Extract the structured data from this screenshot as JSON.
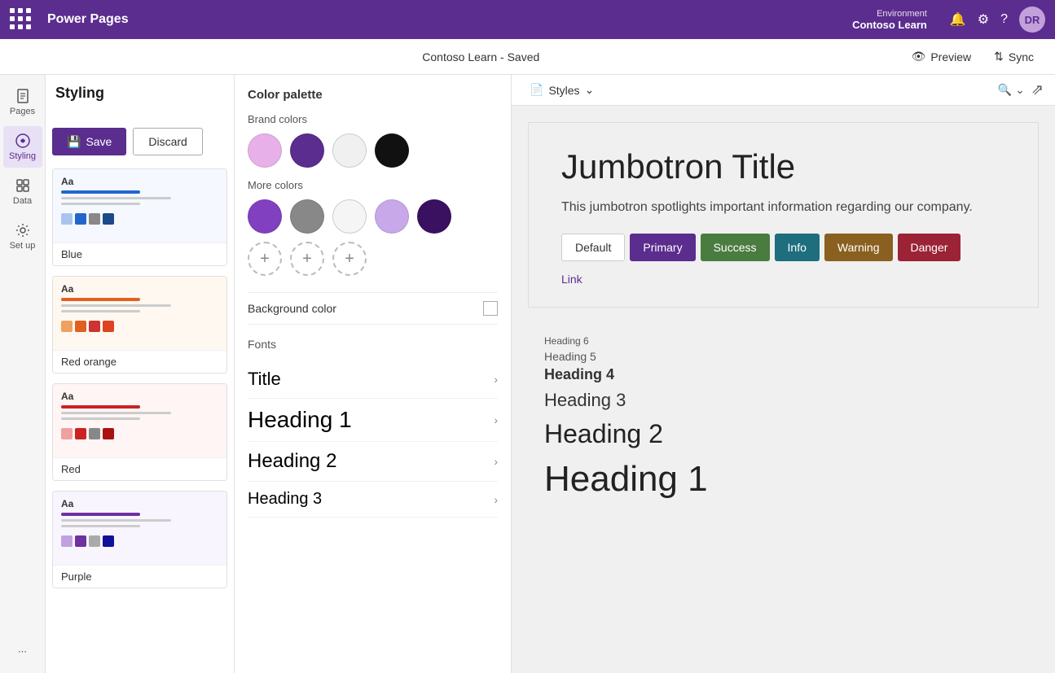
{
  "topnav": {
    "app_name": "Power Pages",
    "environment_label": "Environment",
    "environment_name": "Contoso Learn",
    "avatar_initials": "DR"
  },
  "secondarybar": {
    "title": "Contoso Learn - Saved",
    "preview_label": "Preview",
    "sync_label": "Sync"
  },
  "sidebar": {
    "items": [
      {
        "id": "pages",
        "label": "Pages"
      },
      {
        "id": "styling",
        "label": "Styling"
      },
      {
        "id": "data",
        "label": "Data"
      },
      {
        "id": "setup",
        "label": "Set up"
      }
    ]
  },
  "themes_panel": {
    "header": "Styling",
    "save_label": "Save",
    "discard_label": "Discard",
    "themes": [
      {
        "name": "Blue",
        "bar_color": "#2266cc",
        "swatches": [
          "#aac4f0",
          "#2266cc",
          "#888888",
          "#1a4a8a"
        ]
      },
      {
        "name": "Red orange",
        "bar_color": "#e06020",
        "swatches": [
          "#f0a060",
          "#e06020",
          "#cc3333",
          "#dd4422"
        ]
      },
      {
        "name": "Red",
        "bar_color": "#cc2222",
        "swatches": [
          "#f0a0a0",
          "#cc2222",
          "#888888",
          "#aa1111"
        ]
      },
      {
        "name": "Purple",
        "bar_color": "#7030a0",
        "swatches": [
          "#c0a0e0",
          "#7030a0",
          "#aaaaaa",
          "#111199"
        ]
      }
    ]
  },
  "color_palette": {
    "section_title": "Color palette",
    "brand_colors_label": "Brand colors",
    "brand_colors": [
      {
        "hex": "#e8b0e8",
        "name": "light purple"
      },
      {
        "hex": "#5b2d8e",
        "name": "purple"
      },
      {
        "hex": "#f0f0f0",
        "name": "light gray"
      },
      {
        "hex": "#111111",
        "name": "black"
      }
    ],
    "more_colors_label": "More colors",
    "more_colors": [
      {
        "hex": "#8040c0",
        "name": "medium purple"
      },
      {
        "hex": "#888888",
        "name": "gray"
      },
      {
        "hex": "#f5f5f5",
        "name": "near white"
      },
      {
        "hex": "#c8a8e8",
        "name": "lavender"
      },
      {
        "hex": "#3a1060",
        "name": "dark purple"
      }
    ]
  },
  "background_color": {
    "label": "Background color",
    "checked": false
  },
  "fonts": {
    "section_label": "Fonts",
    "items": [
      {
        "label": "Title",
        "size": "title"
      },
      {
        "label": "Heading 1",
        "size": "h1"
      },
      {
        "label": "Heading 2",
        "size": "h2"
      },
      {
        "label": "Heading 3",
        "size": "h3"
      }
    ]
  },
  "preview": {
    "styles_label": "Styles",
    "jumbotron": {
      "title": "Jumbotron Title",
      "text": "This jumbotron spotlights important information regarding our company.",
      "buttons": [
        {
          "label": "Default",
          "style": "default"
        },
        {
          "label": "Primary",
          "style": "primary"
        },
        {
          "label": "Success",
          "style": "success"
        },
        {
          "label": "Info",
          "style": "info"
        },
        {
          "label": "Warning",
          "style": "warning"
        },
        {
          "label": "Danger",
          "style": "danger"
        }
      ],
      "link_label": "Link"
    },
    "headings": [
      {
        "label": "Heading 6",
        "level": "h6"
      },
      {
        "label": "Heading 5",
        "level": "h5"
      },
      {
        "label": "Heading 4",
        "level": "h4"
      },
      {
        "label": "Heading 3",
        "level": "h3"
      },
      {
        "label": "Heading 2",
        "level": "h2"
      },
      {
        "label": "Heading 1",
        "level": "h1"
      }
    ]
  }
}
